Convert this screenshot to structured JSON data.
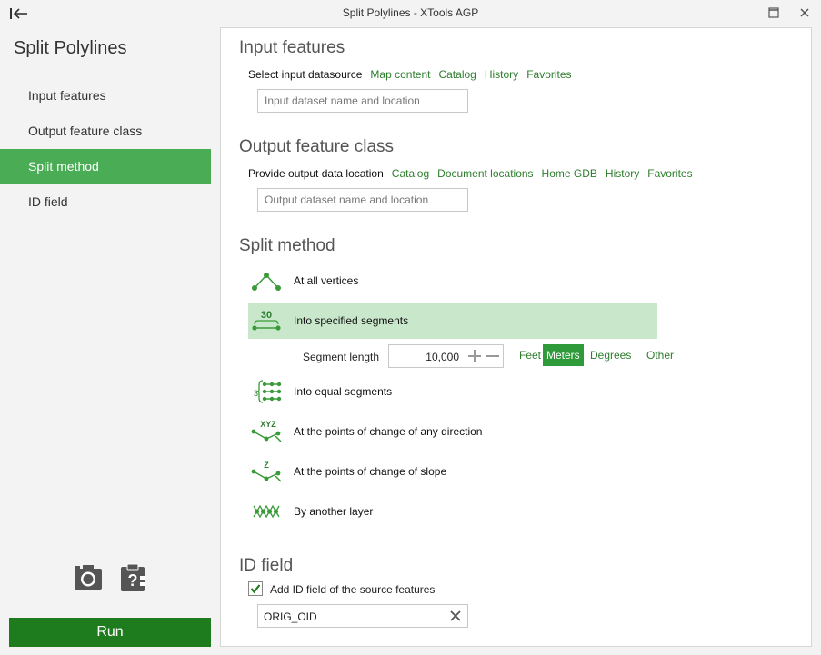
{
  "window": {
    "title": "Split Polylines  -  XTools AGP"
  },
  "sidebar": {
    "title": "Split Polylines",
    "items": [
      {
        "label": "Input features"
      },
      {
        "label": "Output feature class"
      },
      {
        "label": "Split method"
      },
      {
        "label": "ID field"
      }
    ],
    "active_index": 2,
    "run_label": "Run"
  },
  "input": {
    "heading": "Input features",
    "source_label": "Select input datasource",
    "links": [
      "Map content",
      "Catalog",
      "History",
      "Favorites"
    ],
    "placeholder": "Input dataset name and location"
  },
  "output": {
    "heading": "Output feature class",
    "location_label": "Provide output data location",
    "links": [
      "Catalog",
      "Document locations",
      "Home GDB",
      "History",
      "Favorites"
    ],
    "placeholder": "Output dataset name and location"
  },
  "split": {
    "heading": "Split method",
    "methods": [
      {
        "label": "At all vertices",
        "icon": "vertices-icon"
      },
      {
        "label": "Into specified segments",
        "icon": "segments-30-icon",
        "icon_text": "30"
      },
      {
        "label": "Into equal segments",
        "icon": "equal-segments-icon",
        "icon_text": "3"
      },
      {
        "label": "At the points of change of any direction",
        "icon": "xyz-direction-icon",
        "icon_text": "XYZ"
      },
      {
        "label": "At the points of change of slope",
        "icon": "slope-z-icon",
        "icon_text": "Z"
      },
      {
        "label": "By another layer",
        "icon": "another-layer-icon"
      }
    ],
    "selected_index": 1,
    "segment_length_label": "Segment length",
    "segment_length_value": "10,000",
    "units": [
      "Feet",
      "Meters",
      "Degrees",
      "Other"
    ],
    "selected_unit": "Meters"
  },
  "idfield": {
    "heading": "ID field",
    "checkbox_label": "Add ID field of the source features",
    "checked": true,
    "value": "ORIG_OID"
  },
  "colors": {
    "accent": "#4aac55",
    "run": "#1e7b1e",
    "link": "#2d7d2d",
    "selected_row": "#c9e8cb"
  }
}
